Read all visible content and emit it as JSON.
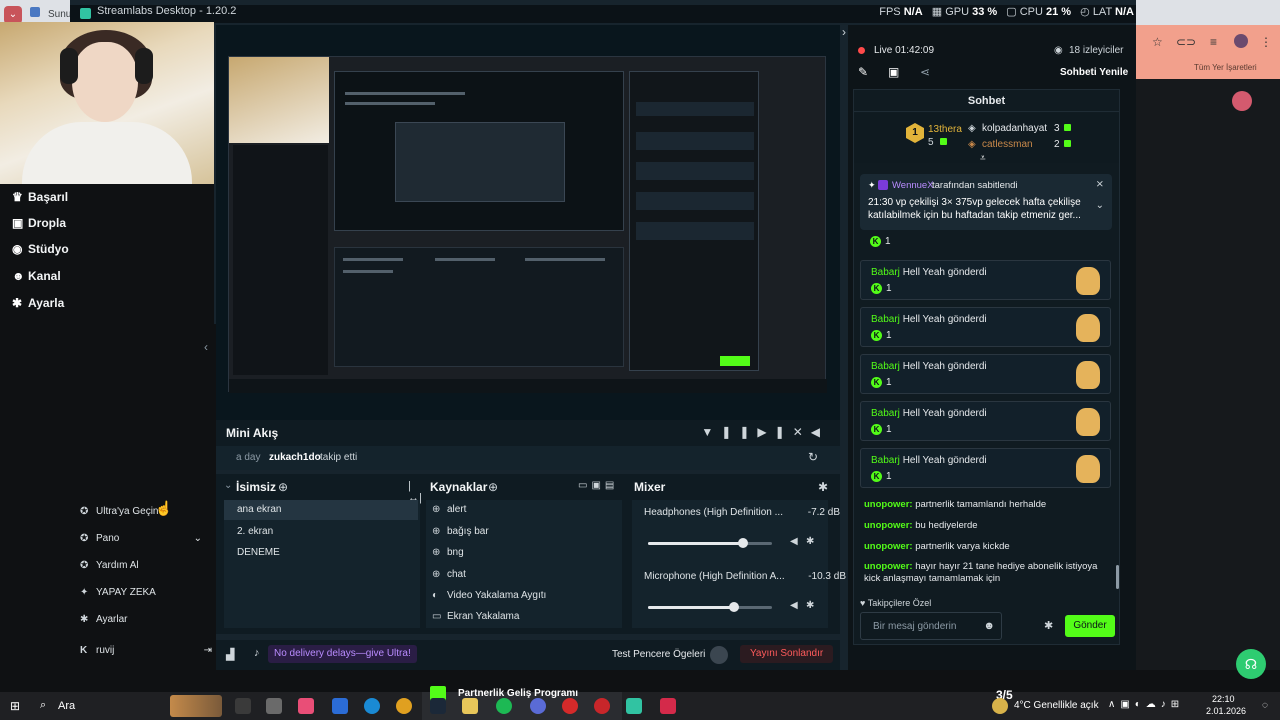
{
  "browser": {
    "tab_label": "Sunuc"
  },
  "app": {
    "title": "Streamlabs Desktop - 1.20.2"
  },
  "perf": {
    "fps_label": "FPS",
    "fps_value": "N/A",
    "gpu_label": "GPU",
    "gpu_value": "33 %",
    "cpu_label": "CPU",
    "cpu_value": "21 %",
    "lat_label": "LAT",
    "lat_value": "N/A"
  },
  "sidebar": {
    "items": [
      {
        "label": "Başarıl",
        "icon": "trophy-icon"
      },
      {
        "label": "Dropla",
        "icon": "gift-icon"
      },
      {
        "label": "Stüdyo",
        "icon": "studio-icon"
      },
      {
        "label": "Kanal",
        "icon": "users-icon"
      },
      {
        "label": "Ayarla",
        "icon": "gear-icon"
      }
    ]
  },
  "leftpanel": {
    "items": [
      {
        "label": "Ultra'ya Geçin",
        "icon": "ultra-icon"
      },
      {
        "label": "Pano",
        "icon": "dashboard-icon"
      },
      {
        "label": "Yardım Al",
        "icon": "help-icon"
      },
      {
        "label": "YAPAY ZEKA",
        "icon": "ai-sparkle-icon"
      },
      {
        "label": "Ayarlar",
        "icon": "gear-icon"
      }
    ],
    "user": "ruvij",
    "user_icon": "kick-icon"
  },
  "miniakis": {
    "title": "Mini Akış",
    "event_time": "a day",
    "event_user": "zukach1do",
    "event_text": "takip etti"
  },
  "scenes": {
    "title": "İsimsiz",
    "items": [
      "ana ekran",
      "2. ekran",
      "DENEME"
    ],
    "selected": 0
  },
  "sources": {
    "title": "Kaynaklar",
    "items": [
      {
        "label": "alert",
        "icon": "globe-icon"
      },
      {
        "label": "bağış bar",
        "icon": "globe-icon"
      },
      {
        "label": "bng",
        "icon": "globe-icon"
      },
      {
        "label": "chat",
        "icon": "globe-icon"
      },
      {
        "label": "Video Yakalama Aygıtı",
        "icon": "webcam-icon"
      },
      {
        "label": "Ekran Yakalama",
        "icon": "monitor-icon"
      }
    ]
  },
  "mixer": {
    "title": "Mixer",
    "channels": [
      {
        "name": "Headphones (High Definition ...",
        "db": "-7.2 dB",
        "level": 0.77
      },
      {
        "name": "Microphone (High Definition A...",
        "db": "-10.3 dB",
        "level": 0.69
      }
    ]
  },
  "footer": {
    "ultra_text": "No delivery delays—give Ultra!",
    "test_label": "Test Pencere Ögeleri",
    "end_label": "Yayını Sonlandır"
  },
  "stream": {
    "live_label": "Live 01:42:09",
    "viewers": "18 izleyiciler",
    "refresh_label": "Sohbeti Yenile",
    "chat_title": "Sohbet"
  },
  "leaderboard": {
    "first_name": "13thera",
    "first_count": "5",
    "entries": [
      {
        "name": "kolpadanhayat",
        "count": "3"
      },
      {
        "name": "catlessman",
        "count": "2"
      }
    ]
  },
  "pinned": {
    "by_user": "WennueX",
    "by_text": "tarafından sabitlendi",
    "message": "21:30 vp çekilişi 3× 375vp gelecek hafta çekilişe katılabilmek için bu haftadan takip etmeniz ger..."
  },
  "chat": {
    "gift_cards": [
      {
        "user": "Babarj",
        "text": "Hell Yeah gönderdi",
        "count": "1"
      },
      {
        "user": "Babarj",
        "text": "Hell Yeah gönderdi",
        "count": "1"
      },
      {
        "user": "Babarj",
        "text": "Hell Yeah gönderdi",
        "count": "1"
      },
      {
        "user": "Babarj",
        "text": "Hell Yeah gönderdi",
        "count": "1"
      },
      {
        "user": "Babarj",
        "text": "Hell Yeah gönderdi",
        "count": "1"
      }
    ],
    "top_card_count": "1",
    "messages": [
      {
        "user": "unopower:",
        "text": "partnerlik tamamlandı herhalde"
      },
      {
        "user": "unopower:",
        "text": "bu hediyelerde"
      },
      {
        "user": "unopower:",
        "text": "partnerlik varya kickde"
      },
      {
        "user": "unopower:",
        "text": "hayır hayır 21 tane hediye abonelik istiyoya kick anlaşmayı tamamlamak için"
      }
    ],
    "follower_only": "Takipçilere Özel",
    "input_placeholder": "Bir mesaj gönderin",
    "send_label": "Gönder"
  },
  "browser_right": {
    "bookmark_label": "Tüm Yer İşaretleri"
  },
  "taskbar": {
    "search": "Ara",
    "notif_title": "Partnerlik Geliş Programı",
    "notif_count": "3/5",
    "weather": "4°C Genellikle açık",
    "time": "22:10",
    "date": "2.01.2026"
  },
  "colors": {
    "kick_green": "#53fc18",
    "app_bg": "#17242d",
    "dock_bg": "#0f1b22",
    "ultra_purple": "#a46bff",
    "end_red": "#ff4a4a"
  }
}
